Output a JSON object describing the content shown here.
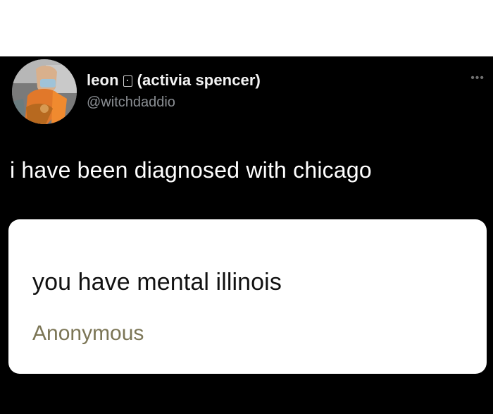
{
  "tweet": {
    "display_name_first": "leon",
    "display_name_second": "(activia spencer)",
    "handle": "@witchdaddio",
    "text": "i have been diagnosed with chicago",
    "more_icon": "more-options-icon"
  },
  "quote_card": {
    "question": "you have mental illinois",
    "author": "Anonymous"
  },
  "colors": {
    "background": "#000000",
    "top_strip": "#ffffff",
    "card": "#ffffff",
    "handle": "#8b8f94",
    "author": "#7b7555"
  }
}
